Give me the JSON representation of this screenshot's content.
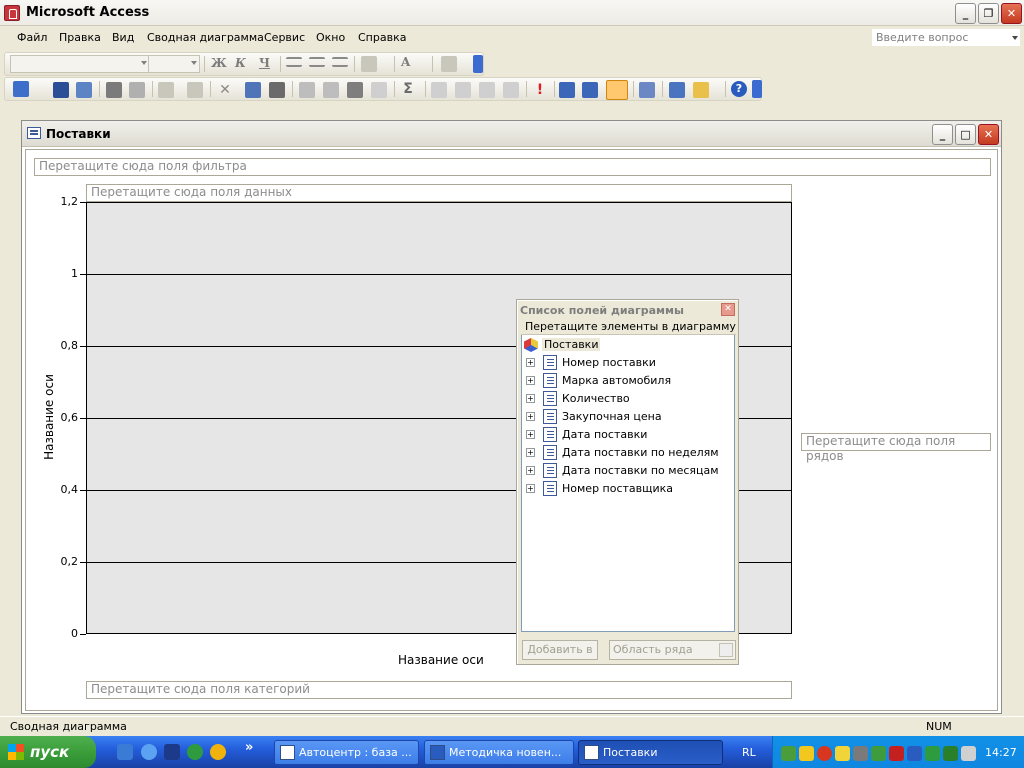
{
  "app": {
    "title": "Microsoft Access"
  },
  "menu": {
    "items": [
      "Файл",
      "Правка",
      "Вид",
      "Сводная диаграмма",
      "Сервис",
      "Окно",
      "Справка"
    ],
    "help_placeholder": "Введите вопрос"
  },
  "mdi": {
    "title": "Поставки"
  },
  "drop_zones": {
    "filter": "Перетащите сюда поля фильтра",
    "data": "Перетащите сюда поля данных",
    "series": "Перетащите сюда поля рядов",
    "category": "Перетащите сюда поля категорий"
  },
  "chart_data": {
    "type": "bar",
    "y_axis_title": "Название оси",
    "x_axis_title": "Название оси",
    "ylim": [
      0,
      1.2
    ],
    "y_ticks": [
      "0",
      "0,2",
      "0,4",
      "0,6",
      "0,8",
      "1",
      "1,2"
    ],
    "categories": [],
    "values": [],
    "grid": true
  },
  "field_list": {
    "title": "Список полей диаграммы",
    "hint": "Перетащите элементы в диаграмму",
    "root": "Поставки",
    "fields": [
      "Номер поставки",
      "Марка автомобиля",
      "Количество",
      "Закупочная цена",
      "Дата поставки",
      "Дата поставки по неделям",
      "Дата поставки по месяцам",
      "Номер поставщика"
    ],
    "add_button": "Добавить в",
    "area_select": "Область ряда"
  },
  "status": {
    "left": "Сводная диаграмма",
    "num": "NUM"
  },
  "taskbar": {
    "start": "пуск",
    "tasks": [
      "Автоцентр : база ...",
      "Методичка новен...",
      "Поставки"
    ],
    "lang": "RL",
    "clock": "14:27",
    "chevron": "»"
  }
}
